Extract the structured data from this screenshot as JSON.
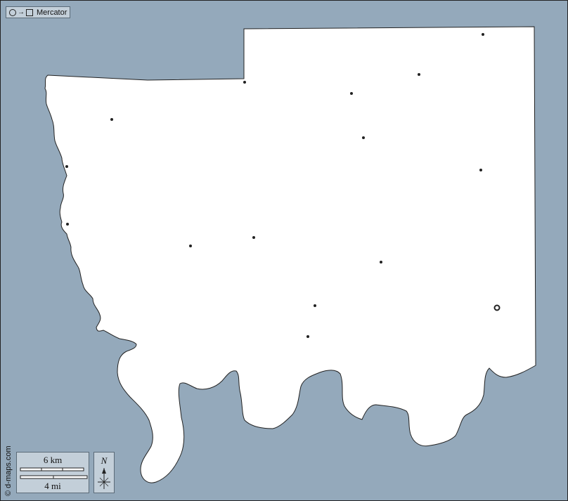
{
  "projection": {
    "label": "Mercator",
    "icon_from": "circle-icon",
    "icon_to": "square-icon",
    "icon_arrow": "→"
  },
  "scale": {
    "km_label": "6 km",
    "mi_label": "4 mi"
  },
  "compass": {
    "north_label": "N"
  },
  "credit": {
    "text": "© d-maps.com"
  },
  "colors": {
    "water": "#94a9bb",
    "land": "#ffffff",
    "outline": "#222222",
    "panel": "#c3cfd9",
    "panel_border": "#5b6b78",
    "city": "#222222"
  },
  "places": {
    "towns_count": 17,
    "capital_marker": "ring"
  }
}
